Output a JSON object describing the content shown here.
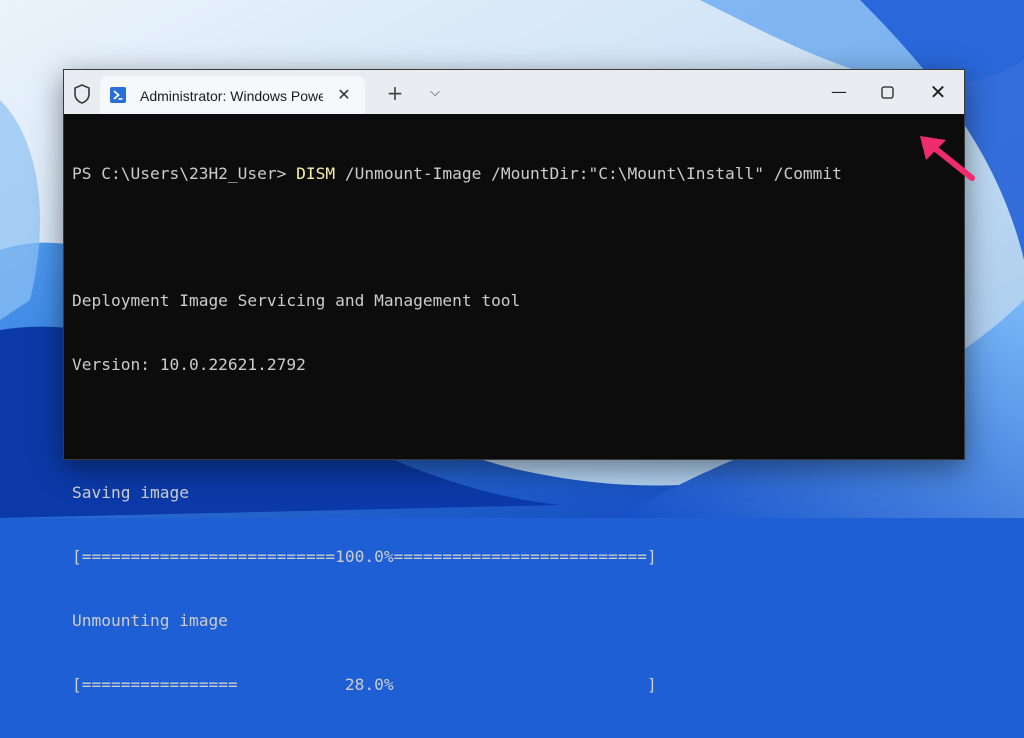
{
  "window": {
    "tab_title": "Administrator: Windows PowerShell",
    "tab_icon": "powershell-icon",
    "controls": [
      "minimize-icon",
      "maximize-icon",
      "close-icon"
    ]
  },
  "console": {
    "prompt": "PS C:\\Users\\23H2_User> ",
    "command": "DISM",
    "args": " /Unmount-Image /MountDir:\"C:\\Mount\\Install\" /Commit",
    "tool_name": "Deployment Image Servicing and Management tool",
    "version": "Version: 10.0.22621.2792",
    "saving_label": "Saving image",
    "saving_bar": "[==========================100.0%==========================]",
    "saving_progress": 100.0,
    "unmount_label": "Unmounting image",
    "unmount_bar": "[================           28.0%                          ]",
    "unmount_progress": 28.0
  },
  "colors": {
    "console_bg": "#0c0c0c",
    "console_text": "#cccccc",
    "command_highlight": "#f9f1a5",
    "titlebar": "#e9edf2",
    "annotation_arrow": "#ee2b6c"
  }
}
